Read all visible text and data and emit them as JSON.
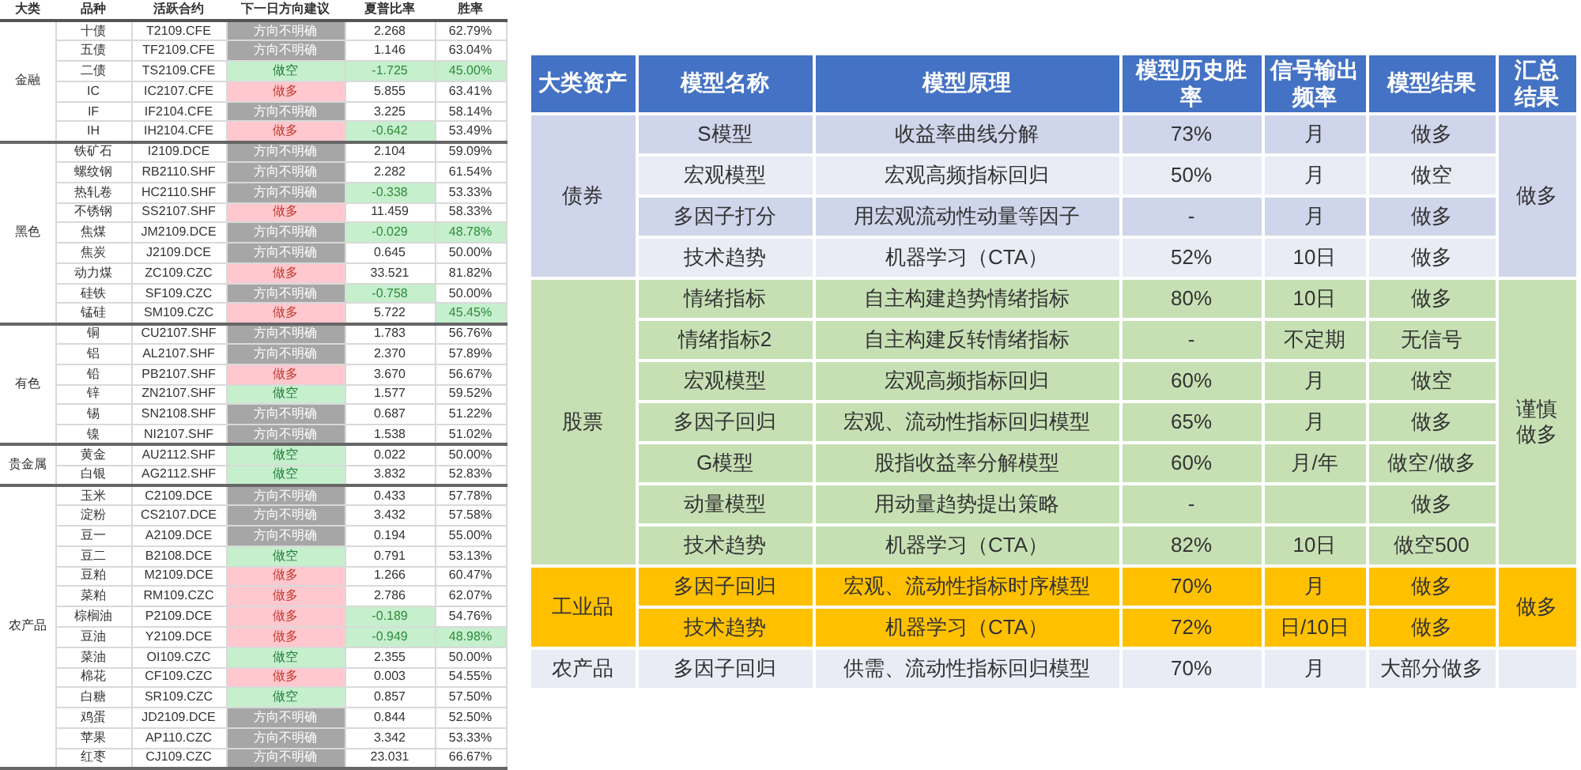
{
  "left_table": {
    "columns": [
      "大类",
      "品种",
      "活跃合约",
      "下一日方向建议",
      "夏普比率",
      "胜率"
    ],
    "groups": [
      {
        "name": "金融",
        "rows": [
          {
            "variety": "十债",
            "contract": "T2109.CFE",
            "direction": {
              "text": "方向不明确",
              "kind": "neutral"
            },
            "sharpe": {
              "text": "2.268",
              "highlight": false
            },
            "win_rate": {
              "text": "62.79%",
              "highlight": false
            }
          },
          {
            "variety": "五债",
            "contract": "TF2109.CFE",
            "direction": {
              "text": "方向不明确",
              "kind": "neutral"
            },
            "sharpe": {
              "text": "1.146",
              "highlight": false
            },
            "win_rate": {
              "text": "63.04%",
              "highlight": false
            }
          },
          {
            "variety": "二债",
            "contract": "TS2109.CFE",
            "direction": {
              "text": "做空",
              "kind": "short"
            },
            "sharpe": {
              "text": "-1.725",
              "highlight": true
            },
            "win_rate": {
              "text": "45.00%",
              "highlight": true
            }
          },
          {
            "variety": "IC",
            "contract": "IC2107.CFE",
            "direction": {
              "text": "做多",
              "kind": "long"
            },
            "sharpe": {
              "text": "5.855",
              "highlight": false
            },
            "win_rate": {
              "text": "63.41%",
              "highlight": false
            }
          },
          {
            "variety": "IF",
            "contract": "IF2104.CFE",
            "direction": {
              "text": "方向不明确",
              "kind": "neutral"
            },
            "sharpe": {
              "text": "3.225",
              "highlight": false
            },
            "win_rate": {
              "text": "58.14%",
              "highlight": false
            }
          },
          {
            "variety": "IH",
            "contract": "IH2104.CFE",
            "direction": {
              "text": "做多",
              "kind": "long"
            },
            "sharpe": {
              "text": "-0.642",
              "highlight": true
            },
            "win_rate": {
              "text": "53.49%",
              "highlight": false
            }
          }
        ]
      },
      {
        "name": "黑色",
        "rows": [
          {
            "variety": "铁矿石",
            "contract": "I2109.DCE",
            "direction": {
              "text": "方向不明确",
              "kind": "neutral"
            },
            "sharpe": {
              "text": "2.104",
              "highlight": false
            },
            "win_rate": {
              "text": "59.09%",
              "highlight": false
            }
          },
          {
            "variety": "螺纹钢",
            "contract": "RB2110.SHF",
            "direction": {
              "text": "方向不明确",
              "kind": "neutral"
            },
            "sharpe": {
              "text": "2.282",
              "highlight": false
            },
            "win_rate": {
              "text": "61.54%",
              "highlight": false
            }
          },
          {
            "variety": "热轧卷",
            "contract": "HC2110.SHF",
            "direction": {
              "text": "方向不明确",
              "kind": "neutral"
            },
            "sharpe": {
              "text": "-0.338",
              "highlight": true
            },
            "win_rate": {
              "text": "53.33%",
              "highlight": false
            }
          },
          {
            "variety": "不锈钢",
            "contract": "SS2107.SHF",
            "direction": {
              "text": "做多",
              "kind": "long"
            },
            "sharpe": {
              "text": "11.459",
              "highlight": false
            },
            "win_rate": {
              "text": "58.33%",
              "highlight": false
            }
          },
          {
            "variety": "焦煤",
            "contract": "JM2109.DCE",
            "direction": {
              "text": "方向不明确",
              "kind": "neutral"
            },
            "sharpe": {
              "text": "-0.029",
              "highlight": true
            },
            "win_rate": {
              "text": "48.78%",
              "highlight": true
            }
          },
          {
            "variety": "焦炭",
            "contract": "J2109.DCE",
            "direction": {
              "text": "方向不明确",
              "kind": "neutral"
            },
            "sharpe": {
              "text": "0.645",
              "highlight": false
            },
            "win_rate": {
              "text": "50.00%",
              "highlight": false
            }
          },
          {
            "variety": "动力煤",
            "contract": "ZC109.CZC",
            "direction": {
              "text": "做多",
              "kind": "long"
            },
            "sharpe": {
              "text": "33.521",
              "highlight": false
            },
            "win_rate": {
              "text": "81.82%",
              "highlight": false
            }
          },
          {
            "variety": "硅铁",
            "contract": "SF109.CZC",
            "direction": {
              "text": "方向不明确",
              "kind": "neutral"
            },
            "sharpe": {
              "text": "-0.758",
              "highlight": true
            },
            "win_rate": {
              "text": "50.00%",
              "highlight": false
            }
          },
          {
            "variety": "锰硅",
            "contract": "SM109.CZC",
            "direction": {
              "text": "做多",
              "kind": "long"
            },
            "sharpe": {
              "text": "5.722",
              "highlight": false
            },
            "win_rate": {
              "text": "45.45%",
              "highlight": true
            }
          }
        ]
      },
      {
        "name": "有色",
        "rows": [
          {
            "variety": "铜",
            "contract": "CU2107.SHF",
            "direction": {
              "text": "方向不明确",
              "kind": "neutral"
            },
            "sharpe": {
              "text": "1.783",
              "highlight": false
            },
            "win_rate": {
              "text": "56.76%",
              "highlight": false
            }
          },
          {
            "variety": "铝",
            "contract": "AL2107.SHF",
            "direction": {
              "text": "方向不明确",
              "kind": "neutral"
            },
            "sharpe": {
              "text": "2.370",
              "highlight": false
            },
            "win_rate": {
              "text": "57.89%",
              "highlight": false
            }
          },
          {
            "variety": "铅",
            "contract": "PB2107.SHF",
            "direction": {
              "text": "做多",
              "kind": "long"
            },
            "sharpe": {
              "text": "3.670",
              "highlight": false
            },
            "win_rate": {
              "text": "56.67%",
              "highlight": false
            }
          },
          {
            "variety": "锌",
            "contract": "ZN2107.SHF",
            "direction": {
              "text": "做空",
              "kind": "short"
            },
            "sharpe": {
              "text": "1.577",
              "highlight": false
            },
            "win_rate": {
              "text": "59.52%",
              "highlight": false
            }
          },
          {
            "variety": "锡",
            "contract": "SN2108.SHF",
            "direction": {
              "text": "方向不明确",
              "kind": "neutral"
            },
            "sharpe": {
              "text": "0.687",
              "highlight": false
            },
            "win_rate": {
              "text": "51.22%",
              "highlight": false
            }
          },
          {
            "variety": "镍",
            "contract": "NI2107.SHF",
            "direction": {
              "text": "方向不明确",
              "kind": "neutral"
            },
            "sharpe": {
              "text": "1.538",
              "highlight": false
            },
            "win_rate": {
              "text": "51.02%",
              "highlight": false
            }
          }
        ]
      },
      {
        "name": "贵金属",
        "rows": [
          {
            "variety": "黄金",
            "contract": "AU2112.SHF",
            "direction": {
              "text": "做空",
              "kind": "short"
            },
            "sharpe": {
              "text": "0.022",
              "highlight": false
            },
            "win_rate": {
              "text": "50.00%",
              "highlight": false
            }
          },
          {
            "variety": "白银",
            "contract": "AG2112.SHF",
            "direction": {
              "text": "做空",
              "kind": "short"
            },
            "sharpe": {
              "text": "3.832",
              "highlight": false
            },
            "win_rate": {
              "text": "52.83%",
              "highlight": false
            }
          }
        ]
      },
      {
        "name": "农产品",
        "rows": [
          {
            "variety": "玉米",
            "contract": "C2109.DCE",
            "direction": {
              "text": "方向不明确",
              "kind": "neutral"
            },
            "sharpe": {
              "text": "0.433",
              "highlight": false
            },
            "win_rate": {
              "text": "57.78%",
              "highlight": false
            }
          },
          {
            "variety": "淀粉",
            "contract": "CS2107.DCE",
            "direction": {
              "text": "方向不明确",
              "kind": "neutral"
            },
            "sharpe": {
              "text": "3.432",
              "highlight": false
            },
            "win_rate": {
              "text": "57.58%",
              "highlight": false
            }
          },
          {
            "variety": "豆一",
            "contract": "A2109.DCE",
            "direction": {
              "text": "方向不明确",
              "kind": "neutral"
            },
            "sharpe": {
              "text": "0.194",
              "highlight": false
            },
            "win_rate": {
              "text": "55.00%",
              "highlight": false
            }
          },
          {
            "variety": "豆二",
            "contract": "B2108.DCE",
            "direction": {
              "text": "做空",
              "kind": "short"
            },
            "sharpe": {
              "text": "0.791",
              "highlight": false
            },
            "win_rate": {
              "text": "53.13%",
              "highlight": false
            }
          },
          {
            "variety": "豆粕",
            "contract": "M2109.DCE",
            "direction": {
              "text": "做多",
              "kind": "long"
            },
            "sharpe": {
              "text": "1.266",
              "highlight": false
            },
            "win_rate": {
              "text": "60.47%",
              "highlight": false
            }
          },
          {
            "variety": "菜粕",
            "contract": "RM109.CZC",
            "direction": {
              "text": "做多",
              "kind": "long"
            },
            "sharpe": {
              "text": "2.786",
              "highlight": false
            },
            "win_rate": {
              "text": "62.07%",
              "highlight": false
            }
          },
          {
            "variety": "棕榈油",
            "contract": "P2109.DCE",
            "direction": {
              "text": "做多",
              "kind": "long"
            },
            "sharpe": {
              "text": "-0.189",
              "highlight": true
            },
            "win_rate": {
              "text": "54.76%",
              "highlight": false
            }
          },
          {
            "variety": "豆油",
            "contract": "Y2109.DCE",
            "direction": {
              "text": "做多",
              "kind": "long"
            },
            "sharpe": {
              "text": "-0.949",
              "highlight": true
            },
            "win_rate": {
              "text": "48.98%",
              "highlight": true
            }
          },
          {
            "variety": "菜油",
            "contract": "OI109.CZC",
            "direction": {
              "text": "做空",
              "kind": "short"
            },
            "sharpe": {
              "text": "2.355",
              "highlight": false
            },
            "win_rate": {
              "text": "50.00%",
              "highlight": false
            }
          },
          {
            "variety": "棉花",
            "contract": "CF109.CZC",
            "direction": {
              "text": "做多",
              "kind": "long"
            },
            "sharpe": {
              "text": "0.003",
              "highlight": false
            },
            "win_rate": {
              "text": "54.55%",
              "highlight": false
            }
          },
          {
            "variety": "白糖",
            "contract": "SR109.CZC",
            "direction": {
              "text": "做空",
              "kind": "short"
            },
            "sharpe": {
              "text": "0.857",
              "highlight": false
            },
            "win_rate": {
              "text": "57.50%",
              "highlight": false
            }
          },
          {
            "variety": "鸡蛋",
            "contract": "JD2109.DCE",
            "direction": {
              "text": "方向不明确",
              "kind": "neutral"
            },
            "sharpe": {
              "text": "0.844",
              "highlight": false
            },
            "win_rate": {
              "text": "52.50%",
              "highlight": false
            }
          },
          {
            "variety": "苹果",
            "contract": "AP110.CZC",
            "direction": {
              "text": "方向不明确",
              "kind": "neutral"
            },
            "sharpe": {
              "text": "3.342",
              "highlight": false
            },
            "win_rate": {
              "text": "53.33%",
              "highlight": false
            }
          },
          {
            "variety": "红枣",
            "contract": "CJ109.CZC",
            "direction": {
              "text": "方向不明确",
              "kind": "neutral"
            },
            "sharpe": {
              "text": "23.031",
              "highlight": false
            },
            "win_rate": {
              "text": "66.67%",
              "highlight": false
            }
          }
        ]
      }
    ]
  },
  "model_table": {
    "columns": [
      "大类资产",
      "模型名称",
      "模型原理",
      "模型历史胜率",
      "信号输出频率",
      "模型结果",
      "汇总结果"
    ],
    "groups": [
      {
        "name": "债券",
        "kind": "bond",
        "summary": "做多",
        "rows": [
          {
            "name": "S模型",
            "principle": "收益率曲线分解",
            "win_rate": "73%",
            "frequency": "月",
            "result": "做多"
          },
          {
            "name": "宏观模型",
            "principle": "宏观高频指标回归",
            "win_rate": "50%",
            "frequency": "月",
            "result": "做空"
          },
          {
            "name": "多因子打分",
            "principle": "用宏观流动性动量等因子",
            "win_rate": "-",
            "frequency": "月",
            "result": "做多"
          },
          {
            "name": "技术趋势",
            "principle": "机器学习（CTA）",
            "win_rate": "52%",
            "frequency": "10日",
            "result": "做多"
          }
        ]
      },
      {
        "name": "股票",
        "kind": "stock",
        "summary": "谨慎做多",
        "rows": [
          {
            "name": "情绪指标",
            "principle": "自主构建趋势情绪指标",
            "win_rate": "80%",
            "frequency": "10日",
            "result": "做多"
          },
          {
            "name": "情绪指标2",
            "principle": "自主构建反转情绪指标",
            "win_rate": "-",
            "frequency": "不定期",
            "result": "无信号"
          },
          {
            "name": "宏观模型",
            "principle": "宏观高频指标回归",
            "win_rate": "60%",
            "frequency": "月",
            "result": "做空"
          },
          {
            "name": "多因子回归",
            "principle": "宏观、流动性指标回归模型",
            "win_rate": "65%",
            "frequency": "月",
            "result": "做多"
          },
          {
            "name": "G模型",
            "principle": "股指收益率分解模型",
            "win_rate": "60%",
            "frequency": "月/年",
            "result": "做空/做多"
          },
          {
            "name": "动量模型",
            "principle": "用动量趋势提出策略",
            "win_rate": "-",
            "result": "做多"
          },
          {
            "name": "技术趋势",
            "principle": "机器学习（CTA）",
            "win_rate": "82%",
            "frequency": "10日",
            "result": "做空500"
          }
        ]
      },
      {
        "name": "工业品",
        "kind": "industrial",
        "summary": "做多",
        "rows": [
          {
            "name": "多因子回归",
            "principle": "宏观、流动性指标时序模型",
            "win_rate": "70%",
            "frequency": "月",
            "result": "做多"
          },
          {
            "name": "技术趋势",
            "principle": "机器学习（CTA）",
            "win_rate": "72%",
            "frequency": "日/10日",
            "result": "做多"
          }
        ]
      },
      {
        "name": "农产品",
        "kind": "agri",
        "rows": [
          {
            "name": "多因子回归",
            "principle": "供需、流动性指标回归模型",
            "win_rate": "70%",
            "frequency": "月",
            "result": "大部分做多"
          }
        ]
      }
    ]
  }
}
